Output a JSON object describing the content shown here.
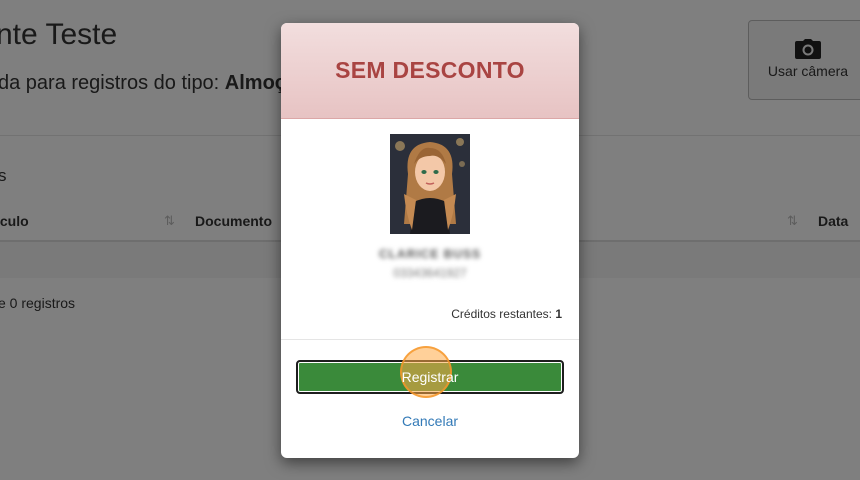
{
  "page": {
    "title": "nte Teste",
    "subtitle_prefix": "da para registros do tipo: ",
    "subtitle_bold": "Almoç",
    "camera_button_label": "Usar câmera",
    "camera_icon": "camera-icon",
    "section_label": "s",
    "table": {
      "headers": [
        "ıculo",
        "Documento",
        "Data"
      ],
      "sort_icon": "⇅"
    },
    "info_text": "e 0 registros"
  },
  "modal": {
    "header_title": "SEM DESCONTO",
    "person_name": "CLARICE BUSS",
    "person_document": "03343641927",
    "credits_label": "Créditos restantes:",
    "credits_value": "1",
    "register_button": "Registrar",
    "cancel_link": "Cancelar"
  },
  "colors": {
    "header_bg": "#f2dede",
    "header_text": "#a94442",
    "register_bg": "#3a8a3a",
    "link": "#337ab7"
  }
}
